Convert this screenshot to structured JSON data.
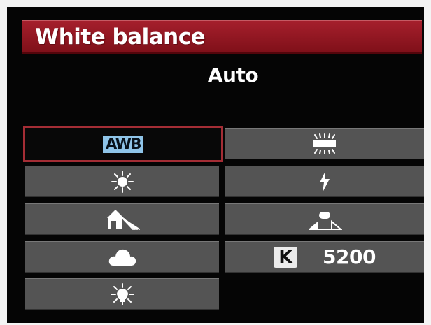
{
  "menu": {
    "title": "White balance",
    "current_mode": "Auto"
  },
  "options": [
    {
      "id": "auto",
      "label": "AWB",
      "icon": "awb-icon",
      "selected": true
    },
    {
      "id": "daylight",
      "label": "",
      "icon": "sun-icon",
      "selected": false
    },
    {
      "id": "shade",
      "label": "",
      "icon": "shade-icon",
      "selected": false
    },
    {
      "id": "cloudy",
      "label": "",
      "icon": "cloud-icon",
      "selected": false
    },
    {
      "id": "tungsten",
      "label": "",
      "icon": "tungsten-icon",
      "selected": false
    },
    {
      "id": "fluorescent",
      "label": "",
      "icon": "fluorescent-icon",
      "selected": false
    },
    {
      "id": "flash",
      "label": "",
      "icon": "flash-icon",
      "selected": false
    },
    {
      "id": "custom",
      "label": "",
      "icon": "custom-wb-icon",
      "selected": false
    },
    {
      "id": "color_temperature",
      "label": "K",
      "value": "5200",
      "icon": "kelvin-icon",
      "selected": false
    }
  ],
  "colors": {
    "title_bar": "#a51f2c",
    "selection_border": "#a42d35",
    "awb_background": "#8fc4e8",
    "option_background": "#545454",
    "screen_background": "#050505"
  }
}
